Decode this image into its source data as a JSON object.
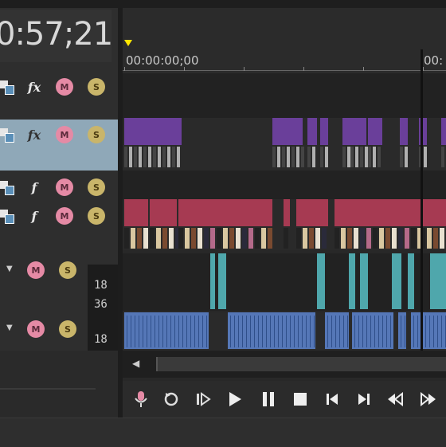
{
  "timecode": "0:57;21",
  "ruler": {
    "start_label": "00:00:00;00",
    "end_label_partial": "00:"
  },
  "tracks": [
    {
      "kind": "video",
      "icons": [
        "compositing-icon",
        "fx-icon",
        "mute-icon",
        "solo-icon"
      ],
      "selected": false
    },
    {
      "kind": "video",
      "icons": [
        "compositing-icon",
        "fx-icon",
        "mute-icon",
        "solo-icon"
      ],
      "selected": true
    },
    {
      "kind": "video",
      "icons": [
        "compositing-icon",
        "track-fx-icon",
        "mute-icon",
        "solo-icon"
      ],
      "selected": false
    },
    {
      "kind": "video",
      "icons": [
        "compositing-icon",
        "track-fx-icon",
        "mute-icon",
        "solo-icon"
      ],
      "selected": false
    },
    {
      "kind": "audio",
      "icons": [
        "chevron-down-icon",
        "mute-icon",
        "solo-icon"
      ],
      "meter_labels": [
        "18",
        "36"
      ]
    },
    {
      "kind": "audio",
      "icons": [
        "chevron-down-icon",
        "mute-icon",
        "solo-icon"
      ],
      "meter_labels": [
        "18"
      ]
    }
  ],
  "colors": {
    "purple_clip": "#6a3f9a",
    "red_clip": "#a63a52",
    "teal_clip": "#4fa7ac",
    "blue_clip": "#5577b7",
    "selection": "#8fa8b8",
    "playhead_marker": "#ffe600"
  },
  "transport": [
    "record-icon",
    "loop-icon",
    "play-from-start-icon",
    "play-icon",
    "pause-icon",
    "stop-icon",
    "prev-frame-icon",
    "next-frame-icon",
    "rewind-icon",
    "fast-forward-icon"
  ]
}
